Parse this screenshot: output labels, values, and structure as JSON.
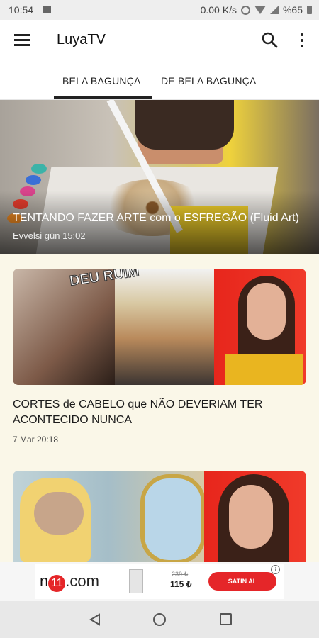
{
  "status_bar": {
    "time": "10:54",
    "net_speed": "0.00 K/s",
    "battery": "%65"
  },
  "app_bar": {
    "title": "LuyaTV"
  },
  "tabs": [
    {
      "label": "BELA BAGUNÇA",
      "active": true
    },
    {
      "label": "DE BELA BAGUNÇA",
      "active": false
    }
  ],
  "featured_video": {
    "title": "TENTANDO FAZER ARTE com o ESFREGÃO (Fluid Art)",
    "date": "Evvelsi gün 15:02"
  },
  "videos": [
    {
      "thumbnail_text": "DEU RUIM",
      "title": "CORTES de CABELO que NÃO DEVERIAM TER ACONTECIDO NUNCA",
      "date": "7 Mar 20:18"
    },
    {
      "title": "",
      "date": ""
    }
  ],
  "ad": {
    "brand_prefix": "n",
    "brand_number": "11",
    "brand_suffix": ".com",
    "old_price": "239 ₺",
    "new_price": "115 ₺",
    "cta": "SATIN AL",
    "info": "i"
  },
  "colors": {
    "background": "#faf7e8",
    "accent_red": "#e52629",
    "text_dark": "#1b1b1b"
  }
}
